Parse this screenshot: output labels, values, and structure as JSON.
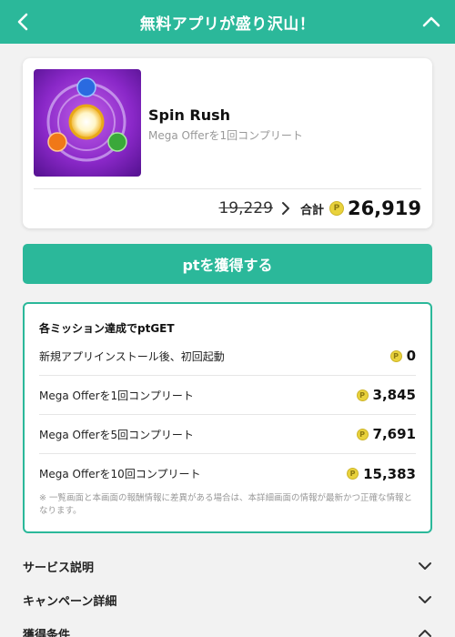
{
  "header": {
    "title": "無料アプリが盛り沢山！"
  },
  "app": {
    "name": "Spin Rush",
    "subtitle": "Mega Offerを1回コンプリート",
    "old_points": "19,229",
    "total_label": "合計",
    "total_points": "26,919",
    "coin_glyph": "P"
  },
  "cta": {
    "label": "ptを獲得する"
  },
  "missions": {
    "heading": "各ミッション達成でptGET",
    "items": [
      {
        "label": "新規アプリインストール後、初回起動",
        "points": "0"
      },
      {
        "label": "Mega Offerを1回コンプリート",
        "points": "3,845"
      },
      {
        "label": "Mega Offerを5回コンプリート",
        "points": "7,691"
      },
      {
        "label": "Mega Offerを10回コンプリート",
        "points": "15,383"
      }
    ],
    "note": "※ 一覧画面と本画面の報酬情報に差異がある場合は、本詳細画面の情報が最新かつ正確な情報となります。"
  },
  "sections": [
    {
      "label": "サービス説明",
      "icon": "chevron-down-icon"
    },
    {
      "label": "キャンペーン詳細",
      "icon": "chevron-down-icon"
    },
    {
      "label": "獲得条件",
      "icon": "chevron-up-icon"
    }
  ],
  "colors": {
    "accent": "#2bb89a",
    "coin": "#e9d23c"
  }
}
